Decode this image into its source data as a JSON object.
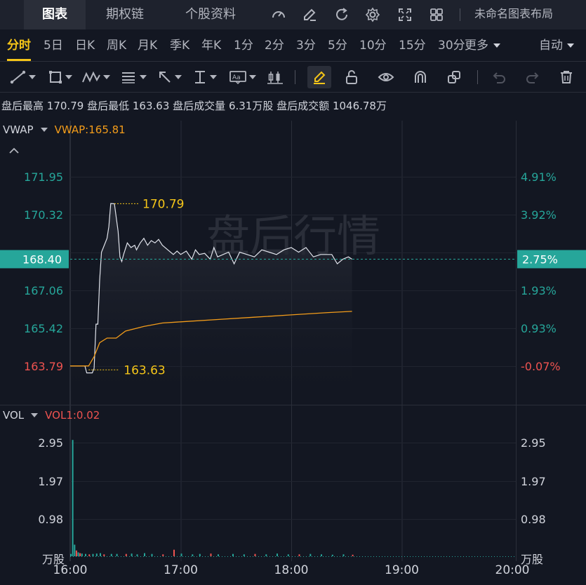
{
  "tabs": [
    {
      "label": "图表",
      "active": true
    },
    {
      "label": "期权链",
      "active": false
    },
    {
      "label": "个股资料",
      "active": false
    }
  ],
  "layout_name": "未命名图表布局",
  "periods": [
    "分时",
    "5日",
    "日K",
    "周K",
    "月K",
    "季K",
    "年K",
    "1分",
    "2分",
    "3分",
    "5分",
    "10分",
    "15分",
    "30分"
  ],
  "active_period": "分时",
  "more_label": "更多",
  "auto_label": "自动",
  "stats": {
    "high_label": "盘后最高",
    "high": "170.79",
    "low_label": "盘后最低",
    "low": "163.63",
    "vol_label": "盘后成交量",
    "vol": "6.31万股",
    "amt_label": "盘后成交额",
    "amt": "1046.78万"
  },
  "vwap": {
    "name": "VWAP",
    "value_label": "VWAP:165.81",
    "color": "#f39c1a"
  },
  "vol_indicator": {
    "name": "VOL",
    "value_label": "VOL1:0.02",
    "color": "#ef5350"
  },
  "watermark": "盘后行情",
  "price_axis": {
    "left": [
      {
        "label": "171.95",
        "color": "#26a69a"
      },
      {
        "label": "170.32",
        "color": "#26a69a"
      },
      {
        "label": "167.06",
        "color": "#26a69a"
      },
      {
        "label": "165.42",
        "color": "#26a69a"
      },
      {
        "label": "163.79",
        "color": "#ef5350"
      }
    ],
    "right": [
      {
        "label": "4.91%",
        "color": "#26a69a"
      },
      {
        "label": "3.92%",
        "color": "#26a69a"
      },
      {
        "label": "1.93%",
        "color": "#26a69a"
      },
      {
        "label": "0.93%",
        "color": "#26a69a"
      },
      {
        "label": "-0.07%",
        "color": "#ef5350"
      }
    ],
    "current_price": "168.40",
    "current_pct": "2.75%"
  },
  "max_annotation": "170.79",
  "min_annotation": "163.63",
  "vol_axis": {
    "labels": [
      "2.95",
      "1.97",
      "0.98"
    ],
    "unit": "万股"
  },
  "time_axis": [
    "16:00",
    "17:00",
    "18:00",
    "19:00",
    "20:00"
  ],
  "colors": {
    "up": "#26a69a",
    "down": "#ef5350",
    "accent": "#f5c518",
    "badge": "#26a69a"
  },
  "chart_data": {
    "type": "line",
    "x_range": [
      "16:00",
      "20:00"
    ],
    "price_ylim": [
      163.3,
      172.6
    ],
    "price": [
      [
        0,
        163.8
      ],
      [
        8,
        163.8
      ],
      [
        9,
        163.5
      ],
      [
        12,
        163.5
      ],
      [
        13,
        163.7
      ],
      [
        14,
        165.6
      ],
      [
        15,
        165.6
      ],
      [
        16,
        167.5
      ],
      [
        17,
        168.7
      ],
      [
        18,
        168.9
      ],
      [
        20,
        169.3
      ],
      [
        21,
        169.8
      ],
      [
        22,
        170.8
      ],
      [
        24,
        170.79
      ],
      [
        26,
        169.6
      ],
      [
        27,
        168.5
      ],
      [
        28,
        168.3
      ],
      [
        29,
        168.6
      ],
      [
        31,
        169.1
      ],
      [
        33,
        168.9
      ],
      [
        35,
        169.0
      ],
      [
        36,
        168.8
      ],
      [
        38,
        169.1
      ],
      [
        40,
        169.3
      ],
      [
        42,
        169.0
      ],
      [
        43,
        169.1
      ],
      [
        44,
        169.2
      ],
      [
        46,
        169.1
      ],
      [
        48,
        169.25
      ],
      [
        50,
        169.0
      ],
      [
        53,
        168.8
      ],
      [
        56,
        168.6
      ],
      [
        58,
        168.75
      ],
      [
        60,
        168.6
      ],
      [
        63,
        168.75
      ],
      [
        66,
        168.4
      ],
      [
        68,
        168.8
      ],
      [
        70,
        168.6
      ],
      [
        73,
        168.65
      ],
      [
        76,
        168.4
      ],
      [
        78,
        168.9
      ],
      [
        80,
        168.5
      ],
      [
        83,
        168.6
      ],
      [
        86,
        168.7
      ],
      [
        89,
        168.2
      ],
      [
        92,
        168.7
      ],
      [
        96,
        168.6
      ],
      [
        100,
        168.5
      ],
      [
        104,
        168.8
      ],
      [
        108,
        168.7
      ],
      [
        112,
        168.6
      ],
      [
        116,
        168.8
      ],
      [
        120,
        168.9
      ],
      [
        124,
        168.7
      ],
      [
        128,
        168.9
      ],
      [
        132,
        168.5
      ],
      [
        136,
        168.6
      ],
      [
        139,
        168.6
      ],
      [
        142,
        168.6
      ],
      [
        145,
        168.2
      ],
      [
        148,
        168.4
      ],
      [
        151,
        168.5
      ],
      [
        153,
        168.4
      ]
    ],
    "vwap": [
      [
        0,
        163.8
      ],
      [
        10,
        163.8
      ],
      [
        13,
        164.2
      ],
      [
        16,
        164.8
      ],
      [
        20,
        165.0
      ],
      [
        25,
        165.0
      ],
      [
        30,
        165.3
      ],
      [
        40,
        165.5
      ],
      [
        50,
        165.65
      ],
      [
        60,
        165.7
      ],
      [
        80,
        165.8
      ],
      [
        100,
        165.9
      ],
      [
        120,
        166.0
      ],
      [
        140,
        166.1
      ],
      [
        153,
        166.15
      ]
    ],
    "volume_ylim": [
      0,
      3.2
    ],
    "volume": [
      [
        0,
        0.06,
        "up"
      ],
      [
        1,
        3.02,
        "up"
      ],
      [
        2,
        0.3,
        "up"
      ],
      [
        3,
        0.15,
        "down"
      ],
      [
        4,
        0.1,
        "up"
      ],
      [
        5,
        0.08,
        "down"
      ],
      [
        6,
        0.07,
        "up"
      ],
      [
        8,
        0.06,
        "up"
      ],
      [
        10,
        0.05,
        "down"
      ],
      [
        12,
        0.06,
        "up"
      ],
      [
        14,
        0.07,
        "up"
      ],
      [
        16,
        0.08,
        "up"
      ],
      [
        18,
        0.05,
        "down"
      ],
      [
        22,
        0.06,
        "up"
      ],
      [
        25,
        0.06,
        "up"
      ],
      [
        30,
        0.06,
        "down"
      ],
      [
        33,
        0.07,
        "up"
      ],
      [
        36,
        0.05,
        "up"
      ],
      [
        40,
        0.08,
        "up"
      ],
      [
        44,
        0.06,
        "up"
      ],
      [
        50,
        0.05,
        "down"
      ],
      [
        56,
        0.17,
        "down"
      ],
      [
        60,
        0.07,
        "up"
      ],
      [
        66,
        0.05,
        "up"
      ],
      [
        70,
        0.06,
        "up"
      ],
      [
        76,
        0.07,
        "down"
      ],
      [
        80,
        0.05,
        "up"
      ],
      [
        88,
        0.06,
        "up"
      ],
      [
        94,
        0.05,
        "up"
      ],
      [
        100,
        0.06,
        "down"
      ],
      [
        106,
        0.05,
        "up"
      ],
      [
        112,
        0.07,
        "up"
      ],
      [
        118,
        0.05,
        "up"
      ],
      [
        124,
        0.05,
        "down"
      ],
      [
        130,
        0.06,
        "up"
      ],
      [
        136,
        0.05,
        "up"
      ],
      [
        142,
        0.04,
        "up"
      ],
      [
        148,
        0.05,
        "up"
      ],
      [
        153,
        0.04,
        "down"
      ]
    ]
  }
}
